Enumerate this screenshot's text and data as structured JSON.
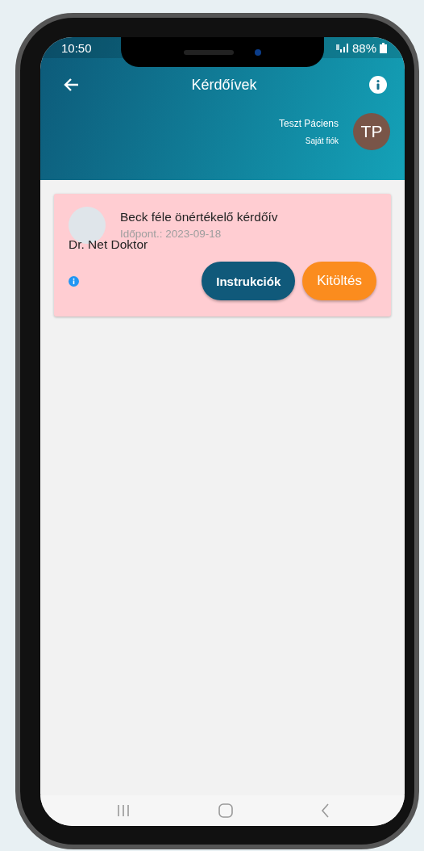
{
  "status_bar": {
    "time": "10:50",
    "battery": "88%"
  },
  "app_bar": {
    "title": "Kérdőívek"
  },
  "account": {
    "name": "Teszt Páciens",
    "subtitle": "Saját fiók",
    "initials": "TP"
  },
  "questionnaires": [
    {
      "title": "Beck féle önértékelő kérdőív",
      "date": "Időpont.: 2023-09-18",
      "doctor": "Dr. Net Doktor",
      "buttons": [
        {
          "label": "Instrukciók",
          "kind": "secondary"
        },
        {
          "label": "Kitöltés",
          "kind": "primary"
        }
      ]
    }
  ]
}
